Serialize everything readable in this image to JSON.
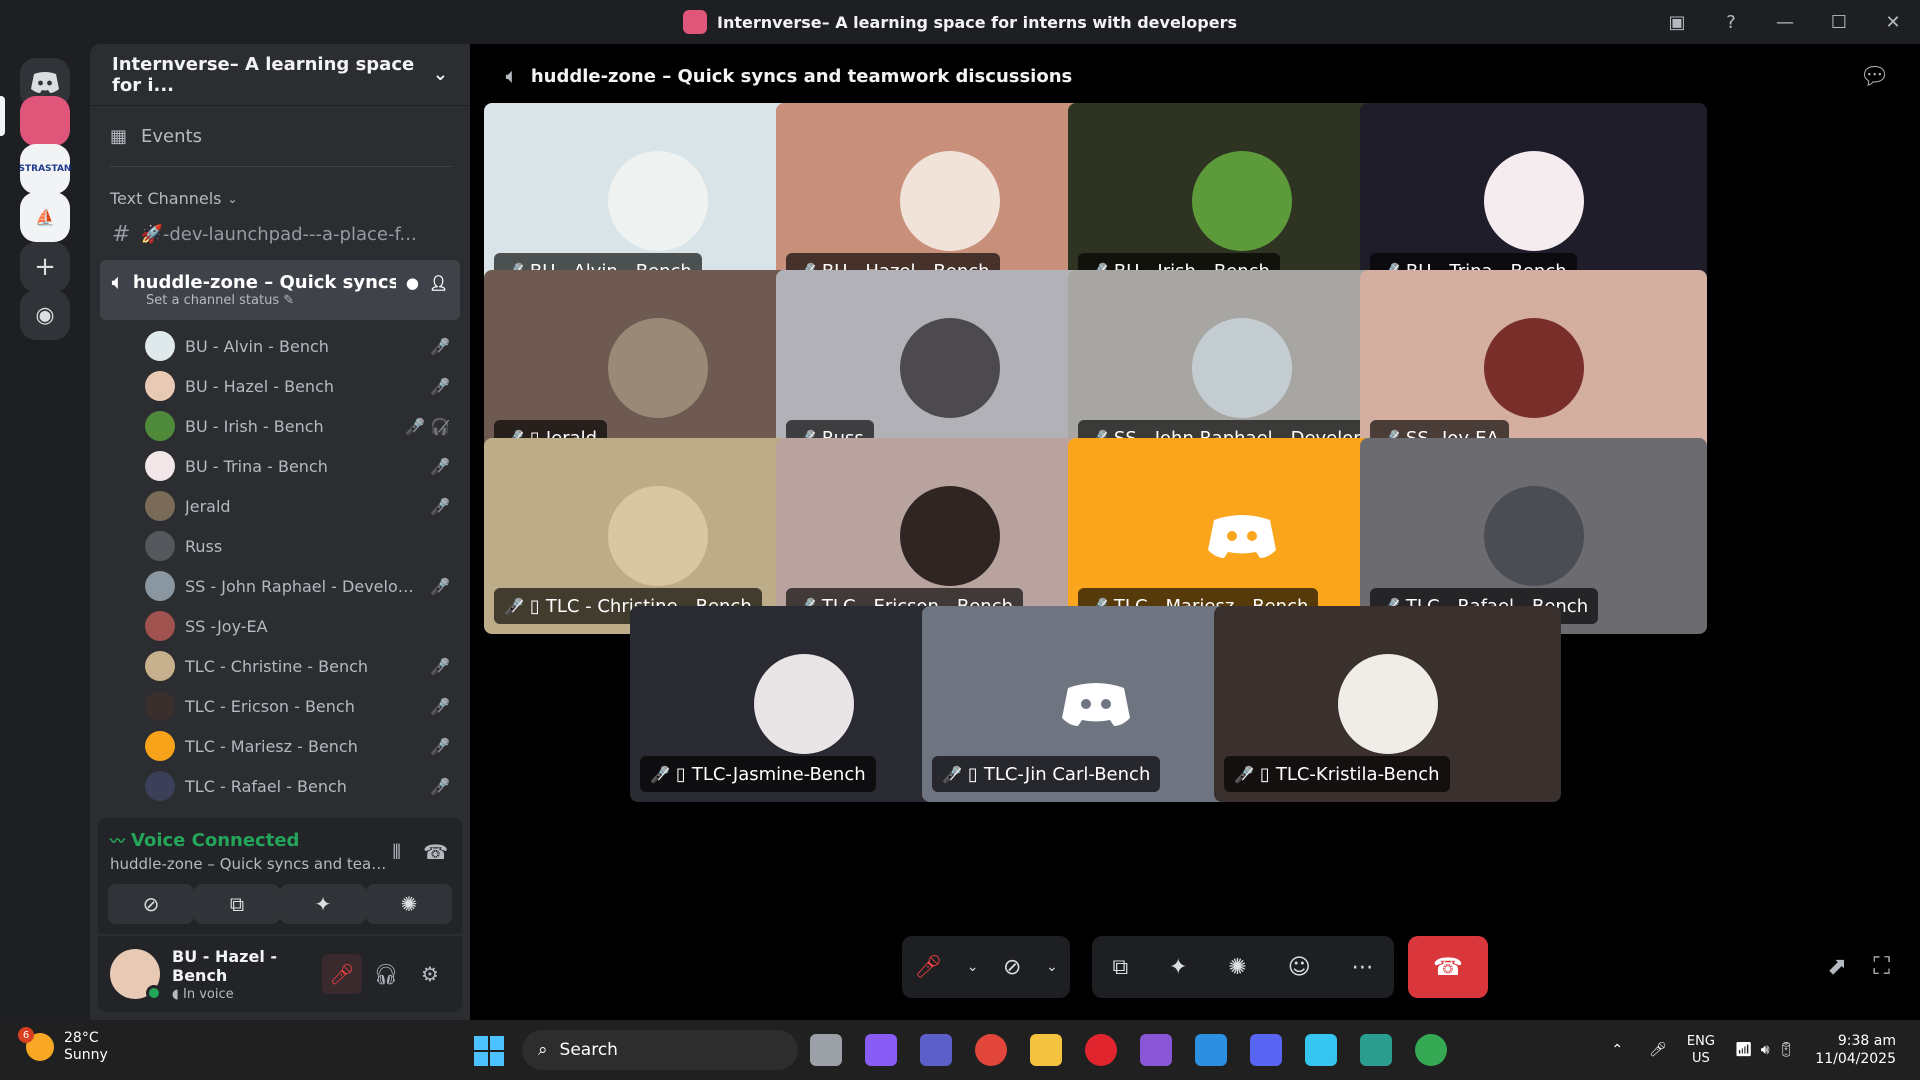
{
  "window": {
    "title": "Internverse– A learning space for interns with developers"
  },
  "server": {
    "name": "Internverse– A learning space for i...",
    "events_label": "Events",
    "category": "Text Channels"
  },
  "text_channel": {
    "name": "🚀-dev-launchpad---a-place-f..."
  },
  "voice_channel": {
    "name": "huddle-zone – Quick syncs...",
    "status": "Set a channel status"
  },
  "members": [
    {
      "name": "BU - Alvin - Bench",
      "color": "#dfe8ea",
      "icons": "🎤̸"
    },
    {
      "name": "BU - Hazel - Bench",
      "color": "#e8c9b3",
      "icons": "🎤̸"
    },
    {
      "name": "BU - Irish - Bench",
      "color": "#4f8a3a",
      "icons": "🎤̸ 🎧̸"
    },
    {
      "name": "BU - Trina - Bench",
      "color": "#f3e6e8",
      "icons": "🎤̸"
    },
    {
      "name": "Jerald",
      "color": "#7a6a58",
      "icons": "🎤̸"
    },
    {
      "name": "Russ",
      "color": "#55575c",
      "icons": ""
    },
    {
      "name": "SS - John Raphael - Develop...",
      "color": "#8a96a0",
      "icons": "🎤̸"
    },
    {
      "name": "SS -Joy-EA",
      "color": "#a0524e",
      "icons": ""
    },
    {
      "name": "TLC - Christine - Bench",
      "color": "#c7b08e",
      "icons": "🎤̸"
    },
    {
      "name": "TLC - Ericson - Bench",
      "color": "#3a2f2c",
      "icons": "🎤̸"
    },
    {
      "name": "TLC - Mariesz - Bench",
      "color": "#f9a31a",
      "icons": "🎤̸"
    },
    {
      "name": "TLC - Rafael - Bench",
      "color": "#3b3f57",
      "icons": "🎤̸"
    }
  ],
  "voice_panel": {
    "title": "Voice Connected",
    "subtitle": "huddle-zone – Quick syncs and teamwork ..."
  },
  "user": {
    "name": "BU - Hazel - Bench",
    "status": "In voice"
  },
  "call": {
    "header": "huddle-zone – Quick syncs and teamwork discussions"
  },
  "tiles": [
    {
      "label": "BU - Alvin - Bench",
      "bg": "#d8e4e8",
      "av": "#eef2f1",
      "mobile": false
    },
    {
      "label": "BU - Hazel - Bench",
      "bg": "#c8907a",
      "av": "#f1e3d9",
      "mobile": false
    },
    {
      "label": "BU - Irish - Bench",
      "bg": "#2e3421",
      "av": "#5c9a3a",
      "mobile": false
    },
    {
      "label": "BU - Trina - Bench",
      "bg": "#201d2a",
      "av": "#f5ecef",
      "mobile": false
    },
    {
      "label": "Jerald",
      "bg": "#6e5a51",
      "av": "#9a8977",
      "mobile": true
    },
    {
      "label": "Russ",
      "bg": "#b3b1b8",
      "av": "#4c4a4e",
      "mobile": false
    },
    {
      "label": "SS - John Raphael - Developer",
      "bg": "#a7a6a2",
      "av": "#c4cdd2",
      "mobile": false
    },
    {
      "label": "SS -Joy-EA",
      "bg": "#d4aea0",
      "av": "#7a2e2a",
      "mobile": false
    },
    {
      "label": "TLC - Christine - Bench",
      "bg": "#bcad88",
      "av": "#d9c7a2",
      "mobile": true
    },
    {
      "label": "TLC - Ericson - Bench",
      "bg": "#b8a39f",
      "av": "#2f2624",
      "mobile": false
    },
    {
      "label": "TLC - Mariesz - Bench",
      "bg": "#faa51b",
      "av": "#faa51b",
      "mobile": false
    },
    {
      "label": "TLC - Rafael - Bench",
      "bg": "#6c6c70",
      "av": "#4b4d55",
      "mobile": false
    },
    {
      "label": "TLC-Jasmine-Bench",
      "bg": "#2a2a33",
      "av": "#e9e4e6",
      "mobile": true
    },
    {
      "label": "TLC-Jin Carl-Bench",
      "bg": "#6e7480",
      "av": "#6e7480",
      "mobile": true
    },
    {
      "label": "TLC-Kristila-Bench",
      "bg": "#3a302d",
      "av": "#f0ece8",
      "mobile": true
    }
  ],
  "taskbar": {
    "weather_temp": "28°C",
    "weather_desc": "Sunny",
    "weather_badge": "6",
    "search_label": "Search",
    "lang_top": "ENG",
    "lang_bottom": "US",
    "time": "9:38 am",
    "date": "11/04/2025"
  }
}
